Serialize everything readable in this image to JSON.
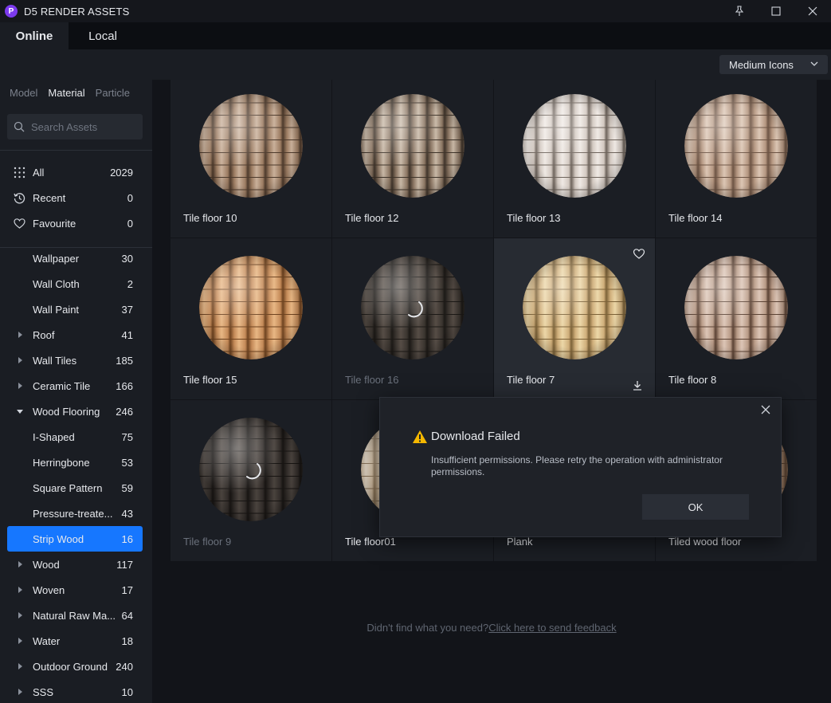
{
  "app": {
    "title": "D5 RENDER ASSETS",
    "logo_letter": "P"
  },
  "topnav": {
    "tabs": [
      {
        "label": "Online",
        "active": true
      },
      {
        "label": "Local",
        "active": false
      }
    ]
  },
  "toolbar": {
    "view_mode": "Medium Icons"
  },
  "sidebar": {
    "category_tabs": [
      {
        "label": "Model"
      },
      {
        "label": "Material",
        "active": true
      },
      {
        "label": "Particle"
      }
    ],
    "search": {
      "placeholder": "Search Assets"
    },
    "quick": [
      {
        "label": "All",
        "count": "2029",
        "icon": "grid-dots-icon"
      },
      {
        "label": "Recent",
        "count": "0",
        "icon": "history-icon"
      },
      {
        "label": "Favourite",
        "count": "0",
        "icon": "heart-icon"
      }
    ],
    "tree": [
      {
        "label": "Wallpaper",
        "count": "30",
        "caret": ""
      },
      {
        "label": "Wall Cloth",
        "count": "2",
        "caret": ""
      },
      {
        "label": "Wall Paint",
        "count": "37",
        "caret": ""
      },
      {
        "label": "Roof",
        "count": "41",
        "caret": "right"
      },
      {
        "label": "Wall Tiles",
        "count": "185",
        "caret": "right"
      },
      {
        "label": "Ceramic Tile",
        "count": "166",
        "caret": "right"
      },
      {
        "label": "Wood Flooring",
        "count": "246",
        "caret": "down"
      },
      {
        "label": "I-Shaped",
        "count": "75",
        "caret": ""
      },
      {
        "label": "Herringbone",
        "count": "53",
        "caret": ""
      },
      {
        "label": "Square Pattern",
        "count": "59",
        "caret": ""
      },
      {
        "label": "Pressure-treate...",
        "count": "43",
        "caret": ""
      },
      {
        "label": "Strip Wood",
        "count": "16",
        "caret": "",
        "selected": true
      },
      {
        "label": "Wood",
        "count": "117",
        "caret": "right"
      },
      {
        "label": "Woven",
        "count": "17",
        "caret": "right"
      },
      {
        "label": "Natural Raw Ma...",
        "count": "64",
        "caret": "right"
      },
      {
        "label": "Water",
        "count": "18",
        "caret": "right"
      },
      {
        "label": "Outdoor Ground",
        "count": "240",
        "caret": "right"
      },
      {
        "label": "SSS",
        "count": "10",
        "caret": "right"
      }
    ]
  },
  "assets": [
    {
      "name": "Tile floor 10",
      "base": "#9c7c62",
      "dark": "#4d3a2c",
      "light": "#c9b09a",
      "state": "ready"
    },
    {
      "name": "Tile floor 12",
      "base": "#8a7562",
      "dark": "#3f342a",
      "light": "#c8b8a6",
      "state": "ready"
    },
    {
      "name": "Tile floor 13",
      "base": "#d2c8c0",
      "dark": "#6e645c",
      "light": "#efe9e4",
      "state": "ready"
    },
    {
      "name": "Tile floor 14",
      "base": "#b49680",
      "dark": "#6d5444",
      "light": "#dcc6b4",
      "state": "ready"
    },
    {
      "name": "Tile floor 15",
      "base": "#c48a58",
      "dark": "#6e4320",
      "light": "#e8b784",
      "state": "ready"
    },
    {
      "name": "Tile floor 16",
      "base": "#3a342f",
      "dark": "#1c1916",
      "light": "#564d46",
      "state": "loading"
    },
    {
      "name": "Tile floor 7",
      "base": "#cfae7a",
      "dark": "#7c6238",
      "light": "#ecd7a8",
      "state": "hover"
    },
    {
      "name": "Tile floor 8",
      "base": "#b89a86",
      "dark": "#5b4234",
      "light": "#dcc5b6",
      "state": "ready"
    },
    {
      "name": "Tile floor 9",
      "base": "#302b28",
      "dark": "#171412",
      "light": "#4a433e",
      "state": "loading"
    },
    {
      "name": "Tile floor01",
      "base": "#d7c1a4",
      "dark": "#8c7456",
      "light": "#efe2cf",
      "state": "ready"
    },
    {
      "name": "Plank",
      "base": "#a47e5c",
      "dark": "#5b412b",
      "light": "#cfae8c",
      "state": "ready"
    },
    {
      "name": "Tiled wood floor",
      "base": "#b08c70",
      "dark": "#6a4f3b",
      "light": "#d9bca5",
      "state": "ready"
    }
  ],
  "feedback": {
    "prefix": "Didn't find what you need?",
    "link": "Click here to send feedback"
  },
  "modal": {
    "title": "Download Failed",
    "message": "Insufficient permissions. Please retry the operation with administrator permissions.",
    "ok_label": "OK"
  },
  "colors": {
    "accent": "#1677ff",
    "warning": "#f5b800",
    "brand": "#7c3aed"
  }
}
